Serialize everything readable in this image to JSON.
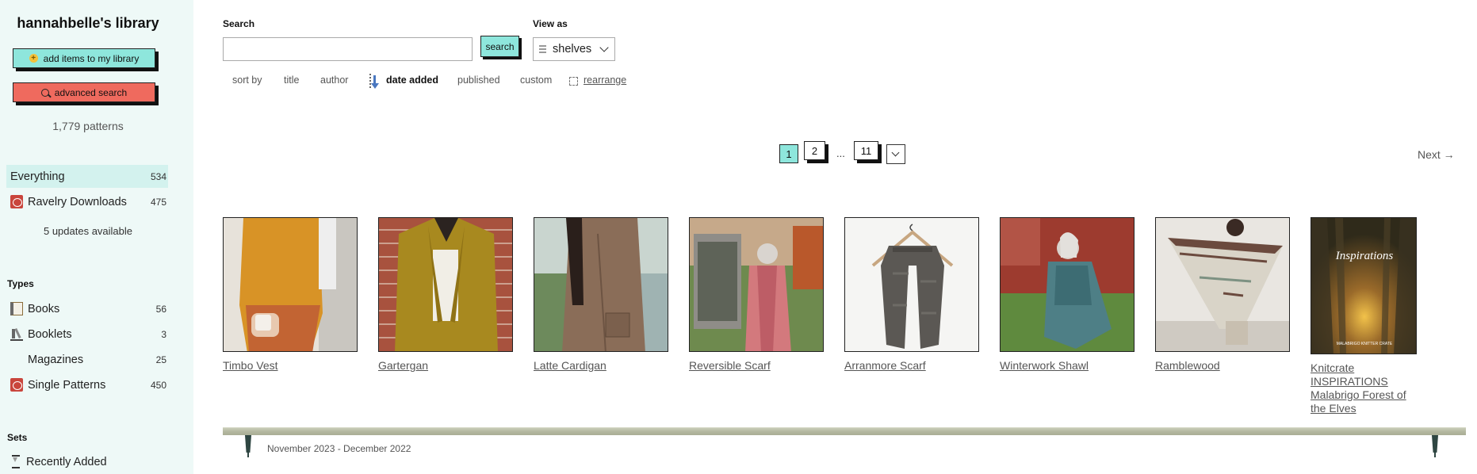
{
  "sidebar": {
    "title": "hannahbelle's library",
    "add_label": "add items to my library",
    "advanced_label": "advanced search",
    "pattern_count": "1,779 patterns",
    "nav": [
      {
        "label": "Everything",
        "count": "534"
      },
      {
        "label": "Ravelry Downloads",
        "count": "475",
        "icon": "pdf-icon"
      }
    ],
    "updates": "5 updates available",
    "types_heading": "Types",
    "types": [
      {
        "label": "Books",
        "count": "56",
        "icon": "book-icon"
      },
      {
        "label": "Booklets",
        "count": "3",
        "icon": "booklet-icon"
      },
      {
        "label": "Magazines",
        "count": "25"
      },
      {
        "label": "Single Patterns",
        "count": "450",
        "icon": "pdf-icon"
      }
    ],
    "sets_heading": "Sets",
    "sets": [
      {
        "label": "Recently Added",
        "icon": "hourglass-icon"
      }
    ]
  },
  "search": {
    "label": "Search",
    "value": "",
    "button": "search"
  },
  "view_as": {
    "label": "View as",
    "selected": "shelves"
  },
  "sort": {
    "label": "sort by",
    "options": [
      "title",
      "author",
      "date added",
      "published",
      "custom"
    ],
    "active": "date added",
    "rearrange": "rearrange"
  },
  "pagination": {
    "pages": [
      "1",
      "2",
      "...",
      "11"
    ],
    "current": "1",
    "next": "Next →"
  },
  "items": [
    {
      "title": "Timbo Vest"
    },
    {
      "title": "Gartergan"
    },
    {
      "title": "Latte Cardigan"
    },
    {
      "title": "Reversible Scarf"
    },
    {
      "title": "Arranmore Scarf"
    },
    {
      "title": "Winterwork Shawl"
    },
    {
      "title": "Ramblewood"
    },
    {
      "title": "Knitcrate INSPIRATIONS Malabrigo Forest of the Elves",
      "cover_title": "Inspirations",
      "cover_sub": "MALABRIGO KNITTER CRATE"
    }
  ],
  "shelf": {
    "date_range": "November 2023 - December 2022"
  },
  "colors": {
    "sidebar_bg": "#eef9f7",
    "accent_teal": "#8ee6dc",
    "accent_red": "#ef6a5e",
    "active_nav": "#d3f2ee"
  }
}
